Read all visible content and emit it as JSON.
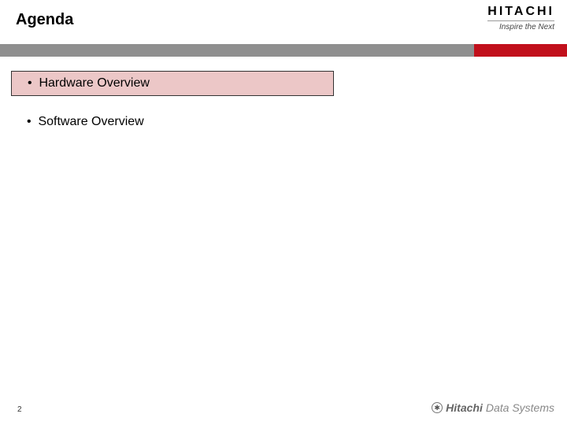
{
  "header": {
    "title": "Agenda",
    "brand_main": "HITACHI",
    "brand_tagline": "Inspire the Next"
  },
  "agenda": {
    "items": [
      {
        "label": "Hardware Overview",
        "highlighted": true
      },
      {
        "label": "Software Overview",
        "highlighted": false
      }
    ]
  },
  "footer": {
    "slide_number": "2",
    "logo_hitachi": "Hitachi",
    "logo_ds": "Data Systems"
  },
  "colors": {
    "accent_red": "#c1101b",
    "bar_gray": "#8f8f8f",
    "highlight_fill": "#ecc7c7"
  }
}
